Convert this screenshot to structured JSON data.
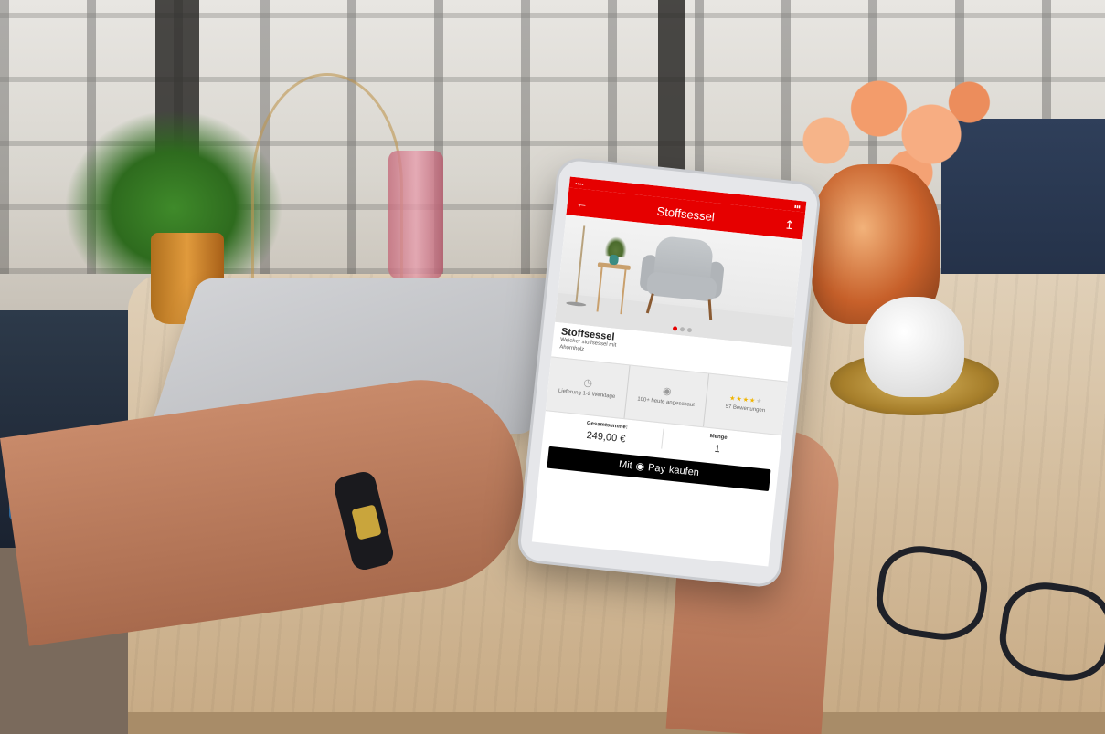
{
  "app": {
    "header_title": "Stoffsessel",
    "back_icon": "arrow-left-icon",
    "share_icon": "share-icon",
    "accent_color": "#e60000"
  },
  "product": {
    "title": "Stoffsessel",
    "description": "Weicher stoffsessel mit Ahornholz",
    "carousel": {
      "pages": 3,
      "active_index": 0
    }
  },
  "info": {
    "delivery": {
      "icon": "clock-icon",
      "label": "Lieferung 1-2 Werktage"
    },
    "views": {
      "icon": "eye-icon",
      "label": "100+ heute angeschaut"
    },
    "rating": {
      "stars_filled": 4,
      "stars_total": 5,
      "label": "57 Bewertungen"
    }
  },
  "purchase": {
    "total_label": "Gesamtsumme:",
    "total_value": "249,00 €",
    "quantity_label": "Menge",
    "quantity_value": "1",
    "pay_prefix": "Mit",
    "pay_brand": "Pay",
    "pay_suffix": "kaufen"
  }
}
